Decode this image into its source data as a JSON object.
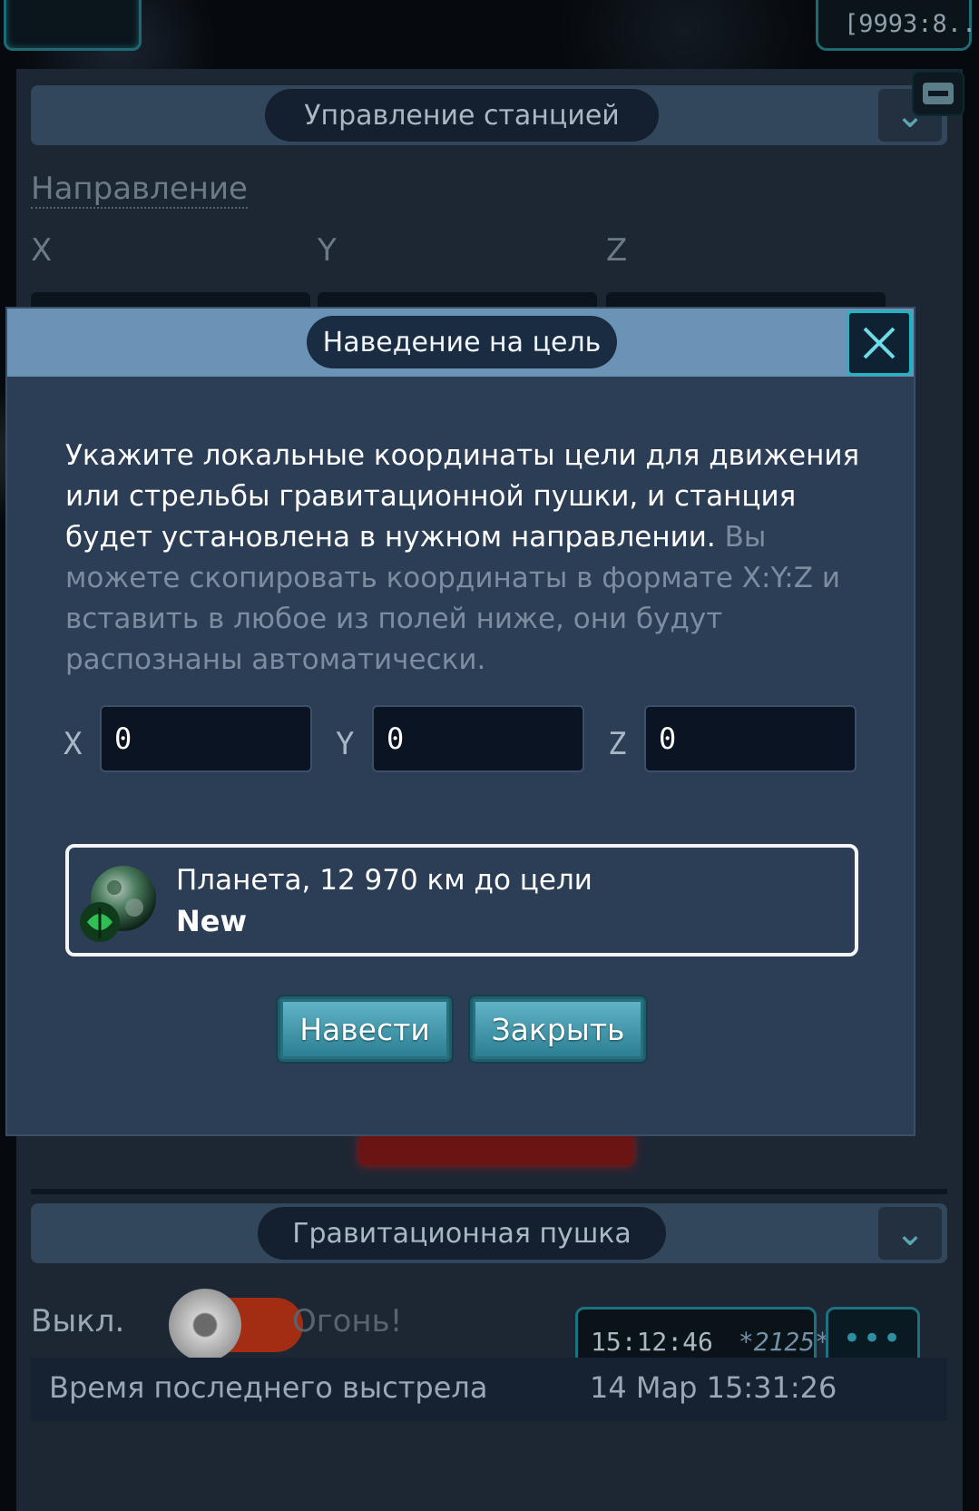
{
  "top_coords": "[9993:8...",
  "station_panel": {
    "header": "Управление станцией",
    "direction_label": "Направление",
    "axis_x": "X",
    "axis_y": "Y",
    "axis_z": "Z"
  },
  "gravity_panel": {
    "header": "Гравитационная пушка",
    "off_label": "Выкл.",
    "fire_label": "Огонь!",
    "last_shot_label": "Время последнего выстрела",
    "last_shot_time": "14 Мар 15:31:26"
  },
  "clock": {
    "time": "15:12:46",
    "tag": "*2125*"
  },
  "chat_button": "•••",
  "modal": {
    "title": "Наведение на цель",
    "description_main": "Укажите локальные координаты цели для движения или стрельбы гравитационной пушки, и станция будет установлена в нужном направлении.",
    "description_hint": "Вы можете скопировать координаты в формате X:Y:Z и вставить в любое из полей ниже, они будут распознаны автоматически.",
    "coords": [
      {
        "label": "X",
        "value": "0"
      },
      {
        "label": "Y",
        "value": "0"
      },
      {
        "label": "Z",
        "value": "0"
      }
    ],
    "target": {
      "line1": "Планета, 12 970 км до цели",
      "line2": "New"
    },
    "aim_button": "Навести",
    "close_button": "Закрыть"
  },
  "colors": {
    "accent_cyan": "#23b4c2",
    "modal_bg": "#2c3e55",
    "header_bg": "#6b93b6",
    "button": "#3f9aae"
  }
}
